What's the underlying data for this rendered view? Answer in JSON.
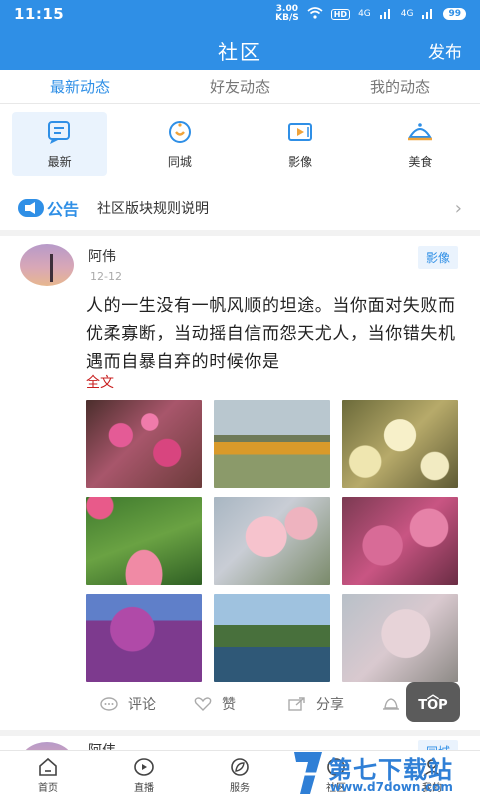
{
  "status_bar": {
    "time": "11:15",
    "speed_value": "3.00",
    "speed_unit": "KB/S",
    "hd": "HD",
    "sig1": "4G",
    "sig2": "4G",
    "battery": "99"
  },
  "header": {
    "title": "社区",
    "publish": "发布"
  },
  "tabs": [
    {
      "label": "最新动态",
      "active": true
    },
    {
      "label": "好友动态"
    },
    {
      "label": "我的动态"
    }
  ],
  "categories": [
    {
      "label": "最新",
      "icon": "note-icon"
    },
    {
      "label": "同城",
      "icon": "location-icon"
    },
    {
      "label": "影像",
      "icon": "video-icon"
    },
    {
      "label": "美食",
      "icon": "food-cover-icon"
    }
  ],
  "notice": {
    "tag": "公告",
    "text": "社区版块规则说明"
  },
  "post": {
    "author": "阿伟",
    "date": "12-12",
    "badge": "影像",
    "content": "人的一生没有一帆风顺的坦途。当你面对失败而优柔寡断，当动摇自信而怨天尤人，当你错失机遇而自暴自弃的时候你是",
    "full_text": "全文",
    "actions": {
      "comment": "评论",
      "like": "赞",
      "share": "分享"
    }
  },
  "post2": {
    "author": "阿伟",
    "badge": "同城"
  },
  "top_button": "TOP",
  "bottom_nav": [
    {
      "label": "首页",
      "icon": "home-icon"
    },
    {
      "label": "直播",
      "icon": "live-icon"
    },
    {
      "label": "服务",
      "icon": "service-icon"
    },
    {
      "label": "社区",
      "icon": "community-icon"
    },
    {
      "label": "我的",
      "icon": "profile-icon"
    }
  ],
  "watermark": {
    "title": "第七下载站",
    "url": "www.d7down.com"
  },
  "colors": {
    "primary": "#2f8fe6",
    "accent_red": "#c81e1e"
  }
}
